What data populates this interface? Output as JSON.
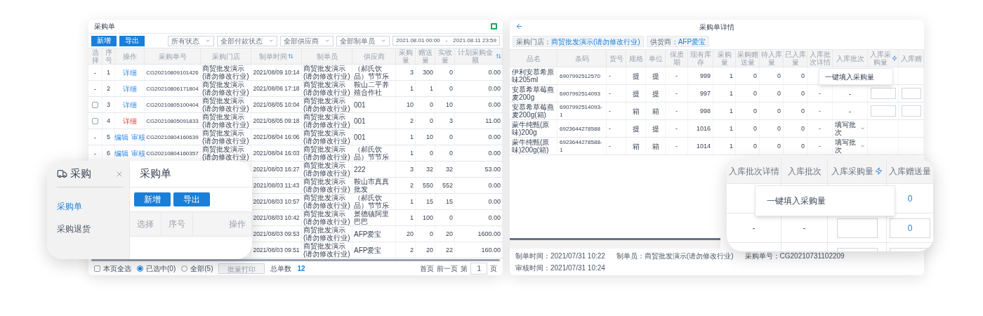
{
  "list_window": {
    "title": "采购单",
    "toolbar_buttons": [
      "新增",
      "导出"
    ],
    "filters": [
      "所有状态",
      "全部付款状态",
      "全部供应商",
      "全部制单员"
    ],
    "date_range": {
      "start": "2021.08.01 00:00",
      "separator": "-",
      "end": "2021.08.11 23:59"
    },
    "table": {
      "columns": [
        {
          "label": "选择",
          "sortable": false
        },
        {
          "label": "序号",
          "sortable": false
        },
        {
          "label": "操作",
          "sortable": false
        },
        {
          "label": "采购单号",
          "sortable": false
        },
        {
          "label": "采购门店",
          "sortable": false
        },
        {
          "label": "制单时间",
          "sortable": true
        },
        {
          "label": "制单员",
          "sortable": false
        },
        {
          "label": "供应商",
          "sortable": false
        },
        {
          "label": "采购量",
          "sortable": false
        },
        {
          "label": "赠送量",
          "sortable": false
        },
        {
          "label": "实收量",
          "sortable": false
        },
        {
          "label": "计划采购金额",
          "sortable": true
        }
      ],
      "rows": [
        {
          "select": {
            "kind": "dash",
            "text": "-"
          },
          "no": "1",
          "actions": [
            {
              "label": "详细",
              "kind": "normal"
            }
          ],
          "order_no": "CG20210809101426",
          "store": "商贸批发演示(请勿修改行业)",
          "created": "2021/08/09 10:14",
          "creator": "商贸批发演示(请勿修改行业)",
          "supplier": "（郝氏饮品）节节乐",
          "qty": "3",
          "gift": "300",
          "received": "0",
          "amount": "0.00"
        },
        {
          "select": {
            "kind": "dash",
            "text": "-"
          },
          "no": "2",
          "actions": [
            {
              "label": "详细",
              "kind": "normal"
            }
          ],
          "order_no": "CG20210806171804",
          "store": "商贸批发演示(请勿修改行业)",
          "created": "2021/08/06 17:18",
          "creator": "商贸批发演示(请勿修改行业)",
          "supplier": "鞍山二平养殖合作社",
          "qty": "1",
          "gift": "1",
          "received": "0",
          "amount": "0.00"
        },
        {
          "select": {
            "kind": "checkbox",
            "checked": false
          },
          "no": "3",
          "actions": [
            {
              "label": "详细",
              "kind": "normal"
            }
          ],
          "order_no": "CG20210805100404",
          "store": "商贸批发演示(请勿修改行业)",
          "created": "2021/08/05 10:04",
          "creator": "商贸批发演示(请勿修改行业)",
          "supplier": "001",
          "qty": "10",
          "gift": "0",
          "received": "10",
          "amount": "0.00"
        },
        {
          "select": {
            "kind": "checkbox",
            "checked": false
          },
          "no": "4",
          "actions": [
            {
              "label": "详细",
              "kind": "warning"
            }
          ],
          "order_no": "CG20210805091833",
          "store": "商贸批发演示(请勿修改行业)",
          "created": "2021/08/05 09:18",
          "creator": "商贸批发演示(请勿修改行业)",
          "supplier": "001",
          "qty": "2",
          "gift": "0",
          "received": "3",
          "amount": "11.00"
        },
        {
          "select": {
            "kind": "dash",
            "text": "-"
          },
          "no": "5",
          "actions": [
            {
              "label": "编辑",
              "kind": "normal"
            },
            {
              "label": "审核",
              "kind": "normal"
            }
          ],
          "order_no": "CG20210804160639",
          "store": "商贸批发演示(请勿修改行业)",
          "created": "2021/08/04 16:06",
          "creator": "商贸批发演示(请勿修改行业)",
          "supplier": "001",
          "qty": "1",
          "gift": "10",
          "received": "0",
          "amount": "0.00"
        },
        {
          "select": {
            "kind": "dash",
            "text": "-"
          },
          "no": "6",
          "actions": [
            {
              "label": "编辑",
              "kind": "normal"
            },
            {
              "label": "审核",
              "kind": "normal"
            }
          ],
          "order_no": "CG20210804160357",
          "store": "商贸批发演示(请勿修改行业)",
          "created": "2021/08/04 16:03",
          "creator": "商贸批发演示(请勿修改行业)",
          "supplier": "（郝氏饮品）节节乐",
          "qty": "1",
          "gift": "0",
          "received": "0",
          "amount": "0.00"
        },
        {
          "created": "2021/08/03 16:27",
          "creator": "商贸批发演示(请勿修改行业)",
          "supplier": "222",
          "qty": "3",
          "gift": "32",
          "received": "32",
          "amount": "53.00"
        },
        {
          "created": "2021/08/03 11:43",
          "creator": "商贸批发演示(请勿修改行业)",
          "supplier": "鞍山市真真批发",
          "qty": "2",
          "gift": "550",
          "received": "552",
          "amount": "0.00"
        },
        {
          "created": "2021/08/03 10:57",
          "creator": "商贸批发演示(请勿修改行业)",
          "supplier": "（郝氏饮品）节节乐",
          "qty": "1",
          "gift": "15",
          "received": "15",
          "amount": "0.00"
        },
        {
          "created": "2021/08/03 10:42",
          "creator": "商贸批发演示(请勿修改行业)",
          "supplier": "景德镇阿里巴巴",
          "qty": "1",
          "gift": "100",
          "received": "0",
          "amount": "0.00"
        },
        {
          "created": "2021/08/03 09:53",
          "creator": "商贸批发演示(请勿修改行业)",
          "supplier": "AFP爱宝",
          "qty": "20",
          "gift": "0",
          "received": "20",
          "amount": "1600.00"
        },
        {
          "created": "2021/08/03 09:51",
          "creator": "商贸批发演示(请勿修改行业)",
          "supplier": "AFP爱宝",
          "qty": "2",
          "gift": "20",
          "received": "22",
          "amount": "160.00"
        }
      ]
    },
    "footer": {
      "select_page": {
        "label": "本页全选",
        "checked": false
      },
      "scope": [
        {
          "label": "已选中(0)",
          "selected": true
        },
        {
          "label": "全部(5)",
          "selected": false
        }
      ],
      "print_button": {
        "label": "批量打印",
        "disabled": true
      },
      "total_label": "总单数",
      "total": "12",
      "pager": {
        "first": "首页",
        "prev": "前一页",
        "page_prefix": "第",
        "page": "1",
        "page_suffix": "页"
      }
    }
  },
  "menu_callout": {
    "module": "采购",
    "nav": [
      {
        "label": "采购单",
        "selected": true
      },
      {
        "label": "采购退货",
        "selected": false
      }
    ],
    "title": "采购单",
    "buttons": [
      "新增",
      "导出"
    ],
    "columns": [
      "选择",
      "序号",
      "操作"
    ]
  },
  "detail_window": {
    "title": "采购单详情",
    "tags": [
      {
        "label": "采购门店：",
        "value": "商贸批发演示(请勿修改行业)"
      },
      {
        "label": "供货商：",
        "value": "AFP爱宝"
      }
    ],
    "table": {
      "columns": [
        {
          "label": "品名",
          "fill_action": false
        },
        {
          "label": "条码",
          "fill_action": false
        },
        {
          "label": "货号",
          "fill_action": false
        },
        {
          "label": "规格",
          "fill_action": false
        },
        {
          "label": "单位",
          "fill_action": false
        },
        {
          "label": "保质期",
          "fill_action": false
        },
        {
          "label": "现有库存",
          "fill_action": false
        },
        {
          "label": "采购量",
          "fill_action": false
        },
        {
          "label": "采购赠送量",
          "fill_action": false
        },
        {
          "label": "待入库量",
          "fill_action": false
        },
        {
          "label": "已入库量",
          "fill_action": false
        },
        {
          "label": "入库批次详情",
          "fill_action": false
        },
        {
          "label": "入库批次",
          "fill_action": false
        },
        {
          "label": "入库采购量",
          "fill_action": true
        },
        {
          "label": "入库赠",
          "fill_action": false
        }
      ],
      "rows": [
        {
          "cells": [
            "伊利安慕希原味205ml",
            "6907992512570",
            "-",
            "提",
            "提",
            "-",
            "999",
            "1",
            "0",
            "0",
            "0"
          ]
        },
        {
          "cells": [
            "安慕希草莓燕麦200g",
            "6907992514093",
            "-",
            "提",
            "提",
            "-",
            "997",
            "1",
            "0",
            "0",
            "0"
          ],
          "batch_detail": "-",
          "batch": {
            "kind": "text",
            "text": "-"
          },
          "inbound_qty": {
            "kind": "input"
          },
          "inbound_gift": {
            "kind": "input"
          }
        },
        {
          "cells": [
            "安慕希草莓燕麦200g(箱)",
            "6907992514093-1",
            "-",
            "箱",
            "箱",
            "-",
            "998",
            "1",
            "0",
            "0",
            "0"
          ],
          "batch_detail": "-",
          "batch": {
            "kind": "text",
            "text": "-"
          },
          "inbound_qty": {
            "kind": "input"
          },
          "inbound_gift": {
            "kind": "input"
          }
        },
        {
          "cells": [
            "蒙牛纯甄(原味)200g",
            "6923644278588",
            "-",
            "提",
            "提",
            "-",
            "1016",
            "1",
            "0",
            "0",
            "0"
          ],
          "batch_detail": "-",
          "batch": {
            "kind": "select",
            "text": "填写批次"
          }
        },
        {
          "cells": [
            "蒙牛纯甄(原味)200g(箱)",
            "6923644278588-1",
            "-",
            "箱",
            "箱",
            "-",
            "1014",
            "1",
            "0",
            "0",
            "0"
          ],
          "batch_detail": "-",
          "batch": {
            "kind": "select",
            "text": "填写批次"
          }
        }
      ]
    },
    "fill_menu": "一键填入采购量",
    "meta": [
      [
        "制单时间：2021/07/31 10:22",
        "制单员：商贸批发演示(请勿修改行业)",
        "采购单号：CG20210731102209"
      ],
      [
        "审核时间：2021/07/31 10:24"
      ]
    ]
  },
  "fill_callout": {
    "columns": [
      {
        "label": "入库批次详情",
        "fill_action": false
      },
      {
        "label": "入库批次",
        "fill_action": false
      },
      {
        "label": "入库采购量",
        "fill_action": true
      },
      {
        "label": "入库赠送量",
        "fill_action": false
      }
    ],
    "menu": "一键填入采购量",
    "rows": [
      {
        "gift": {
          "kind": "text",
          "text": "0"
        }
      },
      {
        "batch_detail": "-",
        "batch": "-",
        "qty": {
          "kind": "input"
        },
        "gift": {
          "kind": "input",
          "text": "0"
        }
      },
      {
        "qty": {
          "kind": "input"
        },
        "gift": {
          "kind": "input"
        }
      }
    ]
  }
}
